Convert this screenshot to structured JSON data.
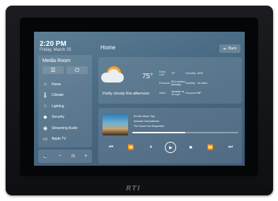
{
  "status": {
    "time": "2:20 PM",
    "date": "Friday, March 25"
  },
  "side": {
    "room": "Media Room",
    "items": [
      {
        "icon": "home-icon",
        "label": "Home"
      },
      {
        "icon": "thermometer-icon",
        "label": "Climate"
      },
      {
        "icon": "bulb-icon",
        "label": "Lighting"
      },
      {
        "icon": "shield-icon",
        "label": "Security"
      },
      {
        "icon": "radio-icon",
        "label": "Streaming Audio"
      },
      {
        "icon": "tv-icon",
        "label": "Apple TV"
      }
    ]
  },
  "volume": {
    "value": "70"
  },
  "header": {
    "title": "Home",
    "back_label": "Back"
  },
  "weather": {
    "temp": "75°",
    "condition": "Partly cloudy this afternoon",
    "feels_like_label": "Feels Like:",
    "feels_like": "72°",
    "humidity_label": "Humidity:",
    "humidity": "42%",
    "pressure_label": "Pressure:",
    "pressure": "30.0 inches (steady)",
    "visibility_label": "Visibility:",
    "visibility": "10 miles",
    "wind_label": "Wind:",
    "wind": "Variable at 10 mph",
    "dewpoint_label": "Dewpoint:",
    "dewpoint": "58°"
  },
  "player": {
    "line1": "It's Not What I Say",
    "line2": "Acoustic Coincidences",
    "line3": "The Sound You Requested",
    "progress": 0.5
  }
}
